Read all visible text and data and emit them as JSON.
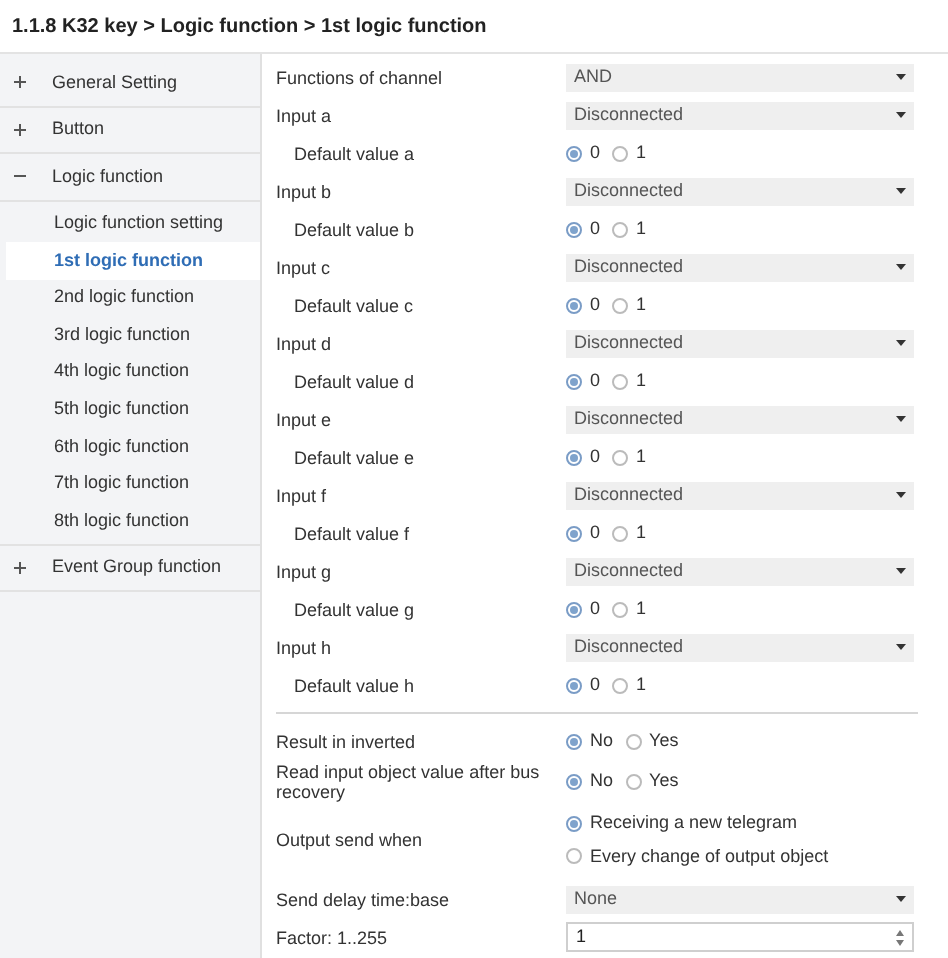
{
  "breadcrumb": "1.1.8 K32 key > Logic function > 1st logic function",
  "sidebar": [
    {
      "label": "General Setting",
      "expanded": false
    },
    {
      "label": "Button",
      "expanded": false
    },
    {
      "label": "Logic function",
      "expanded": true,
      "children": [
        {
          "label": "Logic function setting",
          "selected": false
        },
        {
          "label": "1st logic function",
          "selected": true
        },
        {
          "label": "2nd logic function",
          "selected": false
        },
        {
          "label": "3rd logic function",
          "selected": false
        },
        {
          "label": "4th logic function",
          "selected": false
        },
        {
          "label": "5th logic function",
          "selected": false
        },
        {
          "label": "6th logic function",
          "selected": false
        },
        {
          "label": "7th logic function",
          "selected": false
        },
        {
          "label": "8th logic function",
          "selected": false
        }
      ]
    },
    {
      "label": "Event Group function",
      "expanded": false
    }
  ],
  "params": [
    {
      "kind": "dropdown",
      "label": "Functions of channel",
      "value": "AND"
    },
    {
      "kind": "dropdown",
      "label": "Input a",
      "value": "Disconnected",
      "children": [
        {
          "kind": "radio",
          "label": "Default value a",
          "options": [
            {
              "label": "0",
              "selected": true
            },
            {
              "label": "1",
              "selected": false
            }
          ]
        }
      ]
    },
    {
      "kind": "dropdown",
      "label": "Input b",
      "value": "Disconnected",
      "children": [
        {
          "kind": "radio",
          "label": "Default value b",
          "options": [
            {
              "label": "0",
              "selected": true
            },
            {
              "label": "1",
              "selected": false
            }
          ]
        }
      ]
    },
    {
      "kind": "dropdown",
      "label": "Input c",
      "value": "Disconnected",
      "children": [
        {
          "kind": "radio",
          "label": "Default value c",
          "options": [
            {
              "label": "0",
              "selected": true
            },
            {
              "label": "1",
              "selected": false
            }
          ]
        }
      ]
    },
    {
      "kind": "dropdown",
      "label": "Input d",
      "value": "Disconnected",
      "children": [
        {
          "kind": "radio",
          "label": "Default value d",
          "options": [
            {
              "label": "0",
              "selected": true
            },
            {
              "label": "1",
              "selected": false
            }
          ]
        }
      ]
    },
    {
      "kind": "dropdown",
      "label": "Input e",
      "value": "Disconnected",
      "children": [
        {
          "kind": "radio",
          "label": "Default value e",
          "options": [
            {
              "label": "0",
              "selected": true
            },
            {
              "label": "1",
              "selected": false
            }
          ]
        }
      ]
    },
    {
      "kind": "dropdown",
      "label": "Input f",
      "value": "Disconnected",
      "children": [
        {
          "kind": "radio",
          "label": "Default value f",
          "options": [
            {
              "label": "0",
              "selected": true
            },
            {
              "label": "1",
              "selected": false
            }
          ]
        }
      ]
    },
    {
      "kind": "dropdown",
      "label": "Input g",
      "value": "Disconnected",
      "children": [
        {
          "kind": "radio",
          "label": "Default value g",
          "options": [
            {
              "label": "0",
              "selected": true
            },
            {
              "label": "1",
              "selected": false
            }
          ]
        }
      ]
    },
    {
      "kind": "dropdown",
      "label": "Input h",
      "value": "Disconnected",
      "children": [
        {
          "kind": "radio",
          "label": "Default value h",
          "options": [
            {
              "label": "0",
              "selected": true
            },
            {
              "label": "1",
              "selected": false
            }
          ]
        }
      ]
    },
    {
      "kind": "divider"
    },
    {
      "kind": "radio",
      "label": "Result in inverted",
      "options": [
        {
          "label": "No",
          "selected": true
        },
        {
          "label": "Yes",
          "selected": false
        }
      ]
    },
    {
      "kind": "radio",
      "label": "Read input object value after bus recovery",
      "options": [
        {
          "label": "No",
          "selected": true
        },
        {
          "label": "Yes",
          "selected": false
        }
      ]
    },
    {
      "kind": "radio_list",
      "label": "Output send when",
      "options": [
        {
          "label": "Receiving a new telegram",
          "selected": true
        },
        {
          "label": "Every change of output object",
          "selected": false
        }
      ]
    },
    {
      "kind": "dropdown",
      "label": "Send delay time:base",
      "value": "None"
    },
    {
      "kind": "spinner",
      "label": "Factor: 1..255",
      "value": "1"
    }
  ]
}
